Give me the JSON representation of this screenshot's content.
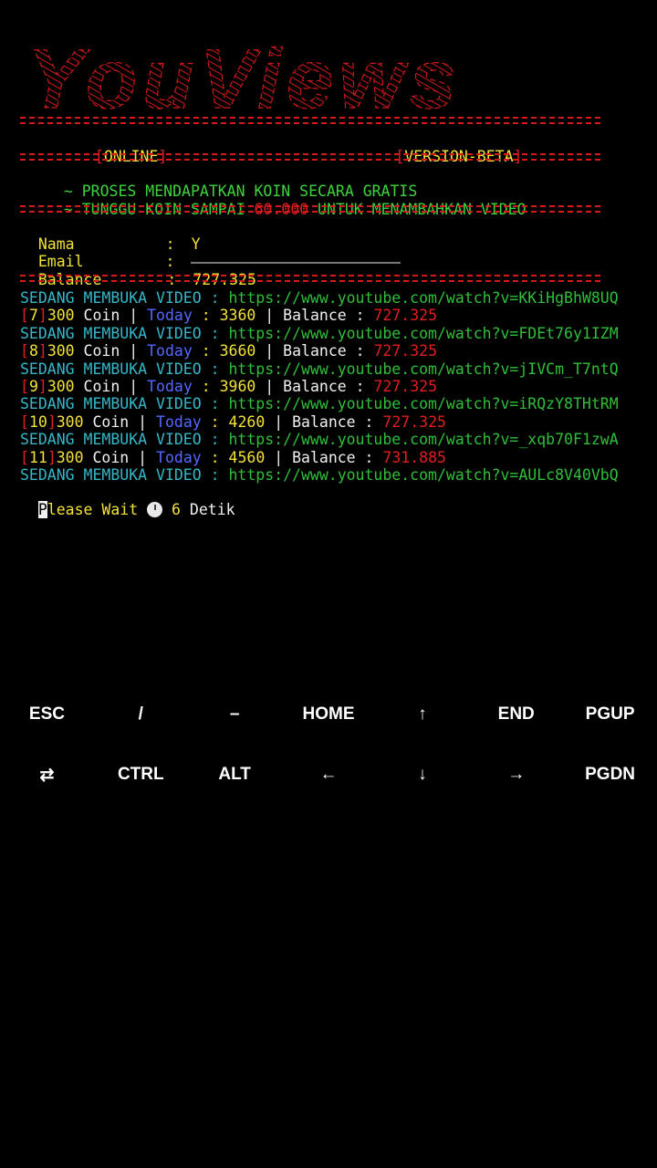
{
  "banner": {
    "title": "YouViews"
  },
  "status": {
    "online": "ONLINE",
    "version": "VERSION-BETA"
  },
  "info": {
    "line1": "~ PROSES MENDAPATKAN KOIN SECARA GRATIS",
    "line2_pre": "~ TUNGGU KOIN SAMPAI ",
    "line2_value": "60.000",
    "line2_post": " UNTUK MENAMBAHKAN VIDEO"
  },
  "account": {
    "name_label": "Nama",
    "email_label": "Email",
    "balance_label": "Balance",
    "colon": ":",
    "name_value": "Y",
    "balance_value": "727.325"
  },
  "log": {
    "opening_label": "SEDANG MEMBUKA VIDEO : ",
    "coin_label": " Coin | ",
    "today_label": "Today",
    "balance_label": " | Balance : ",
    "entries": [
      {
        "url": "https://www.youtube.com/watch?v=KKiHgBhW8UQ",
        "num": "7",
        "coins": "300",
        "today": "3360",
        "balance": "727.325"
      },
      {
        "url": "https://www.youtube.com/watch?v=FDEt76y1IZM",
        "num": "8",
        "coins": "300",
        "today": "3660",
        "balance": "727.325"
      },
      {
        "url": "https://www.youtube.com/watch?v=jIVCm_T7ntQ",
        "num": "9",
        "coins": "300",
        "today": "3960",
        "balance": "727.325"
      },
      {
        "url": "https://www.youtube.com/watch?v=iRQzY8THtRM",
        "num": "10",
        "coins": "300",
        "today": "4260",
        "balance": "727.325"
      },
      {
        "url": "https://www.youtube.com/watch?v=_xqb70F1zwA",
        "num": "11",
        "coins": "300",
        "today": "4560",
        "balance": "731.885"
      }
    ],
    "last_url": "https://www.youtube.com/watch?v=AULc8V40VbQ"
  },
  "wait": {
    "cursor_char": "P",
    "text": "lease Wait ",
    "seconds": "6",
    "unit": " Detik"
  },
  "extra_keys": {
    "row1": [
      "ESC",
      "/",
      "–",
      "HOME",
      "↑",
      "END",
      "PGUP"
    ],
    "row2": [
      "⇄",
      "CTRL",
      "ALT",
      "←",
      "↓",
      "→",
      "PGDN"
    ]
  },
  "colors": {
    "accent_red": "#e21e1e",
    "yellow": "#f2e23a",
    "green": "#3ed33e",
    "cyan": "#35b7c7",
    "blue": "#5468ff"
  }
}
